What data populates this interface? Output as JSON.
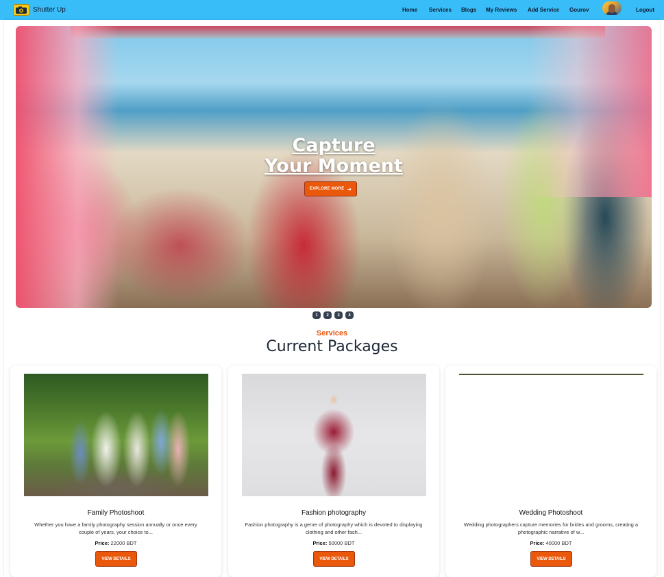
{
  "navbar": {
    "brand": "Shutter Up",
    "links": [
      "Home",
      "Services",
      "Blogs",
      "My Reviews",
      "Add Service",
      "Gourov"
    ],
    "logout": "Logout"
  },
  "hero": {
    "title_line1": "Capture",
    "title_line2": "Your Moment",
    "button_label": "EXPLORE MORE",
    "slides": [
      "1",
      "2",
      "3",
      "4"
    ]
  },
  "section": {
    "subtitle": "Services",
    "title": "Current Packages"
  },
  "cards": [
    {
      "title": "Family Photoshoot",
      "description": "Whether you have a family photography session annually or once every couple of years, your choice to...",
      "price_label": "Price:",
      "price": "22000 BDT",
      "button_label": "VIEW DETAILS"
    },
    {
      "title": "Fashion photography",
      "description": "Fashion photography is a genre of photography which is devoted to displaying clothing and other fash...",
      "price_label": "Price:",
      "price": "50000 BDT",
      "button_label": "VIEW DETAILS"
    },
    {
      "title": "Wedding Photoshoot",
      "description": "Wedding photographers capture memories for brides and grooms, creating a photographic narrative of w...",
      "price_label": "Price:",
      "price": "40000 BDT",
      "button_label": "VIEW DETAILS"
    }
  ],
  "colors": {
    "navbar": "#38bdf8",
    "accent": "#ea580c",
    "heading": "#1f2937"
  }
}
